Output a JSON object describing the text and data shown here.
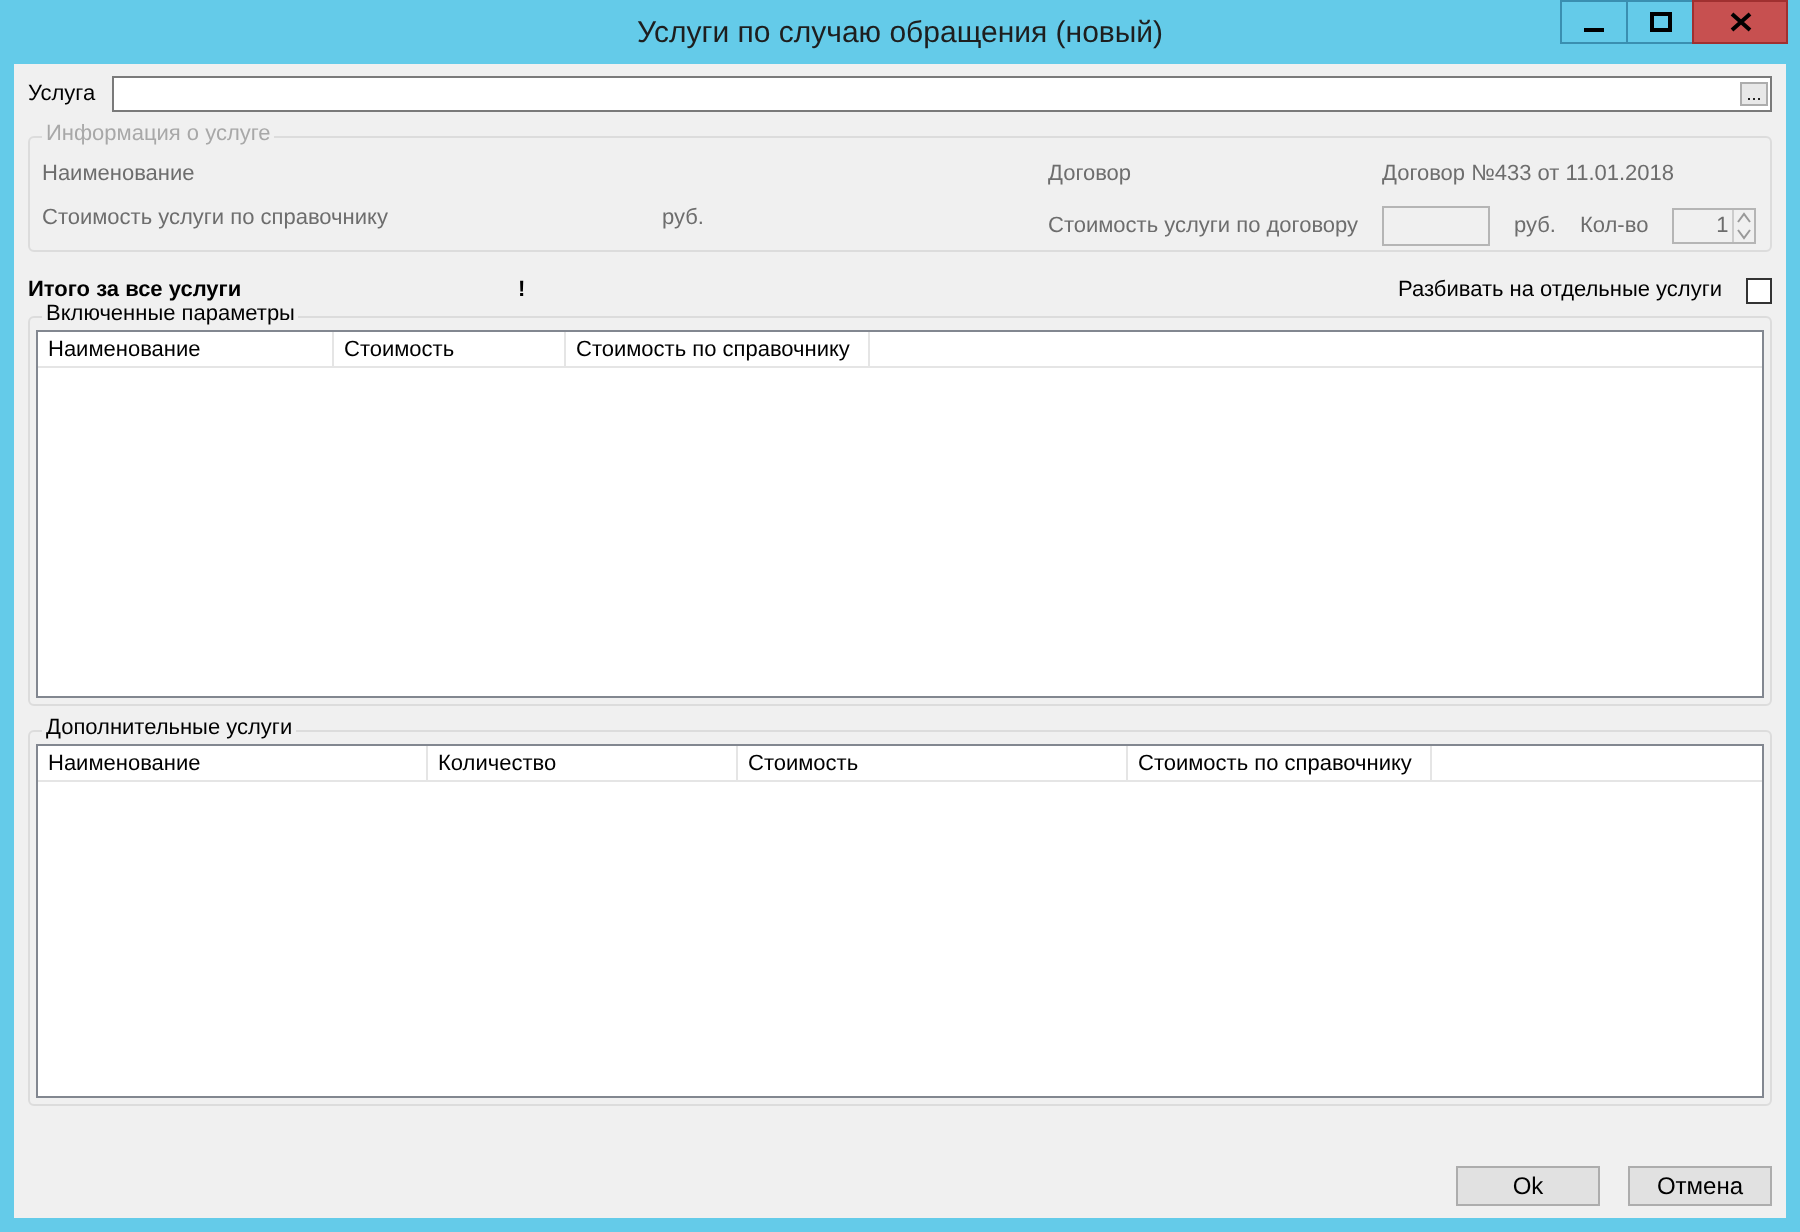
{
  "window": {
    "title": "Услуги по случаю обращения (новый)"
  },
  "service_field": {
    "label": "Услуга",
    "browse": "..."
  },
  "service_info": {
    "title": "Информация о услуге",
    "disabled": true,
    "name_label": "Наименование",
    "contract_label": "Договор",
    "contract_value": "Договор №433 от 11.01.2018",
    "ref_cost_label": "Стоимость услуги по справочнику",
    "ref_cost_unit": "руб.",
    "contract_cost_label": "Стоимость услуги по договору",
    "contract_cost_unit": "руб.",
    "qty_label": "Кол-во",
    "qty_value": "1"
  },
  "total": {
    "label": "Итого за все услуги",
    "value": "!"
  },
  "split": {
    "label": "Разбивать на отдельные услуги",
    "checked": false
  },
  "tables": [
    {
      "title": "Включенные параметры",
      "columns": [
        "Наименование",
        "Стоимость",
        "Стоимость по справочнику"
      ]
    },
    {
      "title": "Дополнительные услуги",
      "columns": [
        "Наименование",
        "Количество",
        "Стоимость",
        "Стоимость по справочнику"
      ]
    }
  ],
  "buttons": [
    "Ok",
    "Отмена"
  ]
}
